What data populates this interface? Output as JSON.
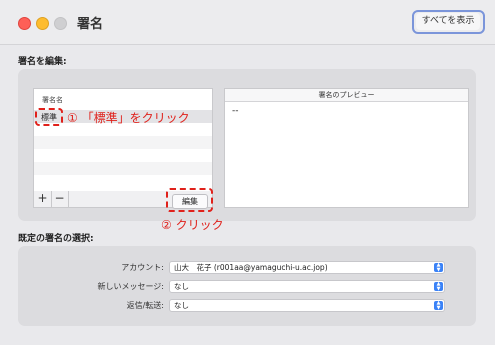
{
  "window": {
    "title": "署名",
    "show_all_label": "すべてを表示"
  },
  "edit_section": {
    "heading": "署名を編集:",
    "list": {
      "header": "署名名",
      "items": [
        {
          "label": "標準"
        }
      ],
      "add_label": "+",
      "remove_label": "−",
      "edit_button_label": "編集"
    },
    "preview": {
      "header": "署名のプレビュー",
      "content": "--"
    }
  },
  "annotations": {
    "step1": "① 「標準」をクリック",
    "step2": "② クリック",
    "accent_color": "#e0211b"
  },
  "default_section": {
    "heading": "既定の署名の選択:",
    "rows": [
      {
        "label": "アカウント:",
        "value": "山大　花子 (r001aa@yamaguchi-u.ac.jop)"
      },
      {
        "label": "新しいメッセージ:",
        "value": "なし"
      },
      {
        "label": "返信/転送:",
        "value": "なし"
      }
    ]
  }
}
